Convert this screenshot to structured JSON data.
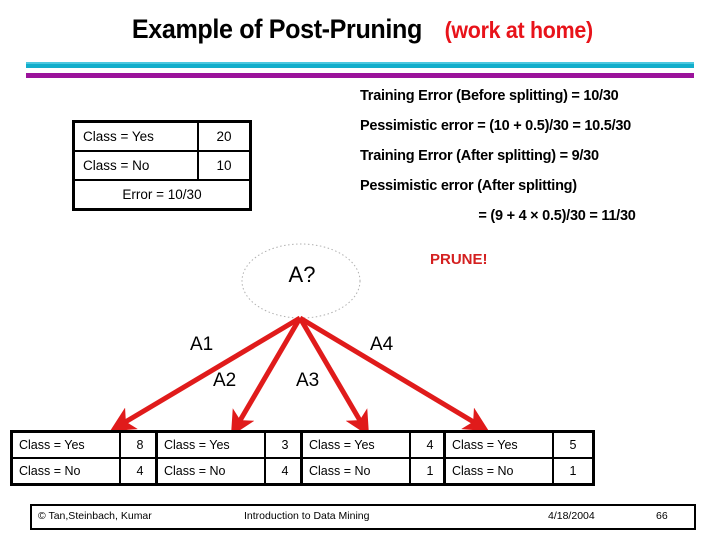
{
  "slide": {
    "title_main": "Example of Post-Pruning",
    "title_sub": "(work at home)",
    "divider_colors": {
      "cyan_light": "#4cc8e0",
      "cyan": "#12aecb",
      "purple": "#9b139b"
    },
    "accent_red": "#e8131a",
    "prune_red": "#d42020"
  },
  "info": {
    "lines": [
      "Training Error (Before splitting) = 10/30",
      "Pessimistic error = (10 + 0.5)/30 = 10.5/30",
      "Training Error (After splitting) = 9/30",
      "Pessimistic error (After splitting)",
      "= (9 + 4 × 0.5)/30 = 11/30"
    ],
    "line_0": "Training Error (Before splitting) = 10/30",
    "line_1": "Pessimistic error = (10 + 0.5)/30 = 10.5/30",
    "line_2": "Training Error (After splitting) = 9/30",
    "line_3": "Pessimistic error (After splitting)",
    "line_4": "= (9 + 4 × 0.5)/30 = 11/30"
  },
  "root_table": {
    "rows": [
      {
        "label": "Class = Yes",
        "count": "20"
      },
      {
        "label": "Class = No",
        "count": "10"
      }
    ],
    "row_0_label": "Class = Yes",
    "row_0_count": "20",
    "row_1_label": "Class = No",
    "row_1_count": "10",
    "error": "Error = 10/30"
  },
  "tree": {
    "root_node_label": "A?",
    "root_node_shape": "dotted-ellipse",
    "branches": [
      {
        "label": "A1"
      },
      {
        "label": "A2"
      },
      {
        "label": "A3"
      },
      {
        "label": "A4"
      }
    ],
    "branch_0": "A1",
    "branch_1": "A2",
    "branch_2": "A3",
    "branch_3": "A4",
    "annotation": "PRUNE!",
    "arrow_color": "#e01b1b"
  },
  "leaves": [
    {
      "yes_label": "Class = Yes",
      "yes_count": "8",
      "no_label": "Class = No",
      "no_count": "4"
    },
    {
      "yes_label": "Class = Yes",
      "yes_count": "3",
      "no_label": "Class = No",
      "no_count": "4"
    },
    {
      "yes_label": "Class = Yes",
      "yes_count": "4",
      "no_label": "Class = No",
      "no_count": "1"
    },
    {
      "yes_label": "Class = Yes",
      "yes_count": "5",
      "no_label": "Class = No",
      "no_count": "1"
    }
  ],
  "footer": {
    "author": "© Tan,Steinbach, Kumar",
    "course": "Introduction to Data Mining",
    "date": "4/18/2004",
    "page": "66"
  }
}
